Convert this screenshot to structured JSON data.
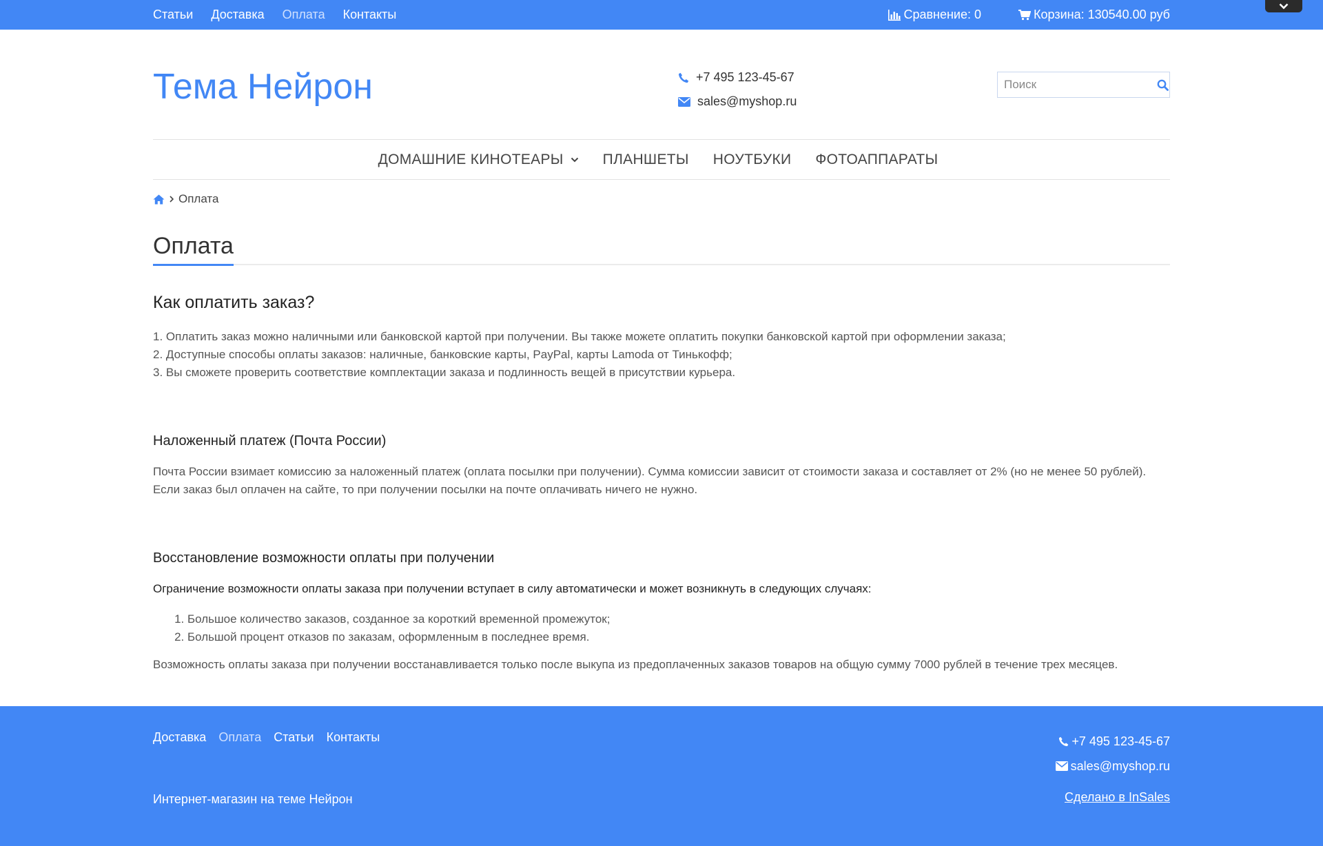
{
  "topbar": {
    "nav": [
      "Статьи",
      "Доставка",
      "Оплата",
      "Контакты"
    ],
    "compare_label": "Сравнение: 0",
    "cart_label": "Корзина: 130540.00 руб"
  },
  "header": {
    "logo": "Тема Нейрон",
    "phone": "+7 495 123-45-67",
    "email": "sales@myshop.ru",
    "search_placeholder": "Поиск"
  },
  "mainnav": [
    "ДОМАШНИЕ КИНОТЕАРЫ",
    "ПЛАНШЕТЫ",
    "НОУТБУКИ",
    "ФОТОАППАРАТЫ"
  ],
  "breadcrumb": {
    "current": "Оплата"
  },
  "page": {
    "title": "Оплата",
    "heading": "Как оплатить заказ?",
    "intro_lines": [
      "1. Оплатить заказ можно наличными или банковской картой при получении. Вы также можете оплатить покупки банковской картой при оформлении заказа;",
      "2. Доступные способы оплаты заказов: наличные, банковские карты, PayPal, карты Lamoda от Тинькофф;",
      "3. Вы сможете проверить соответствие комплектации заказа и подлинность вещей в присутствии курьера."
    ],
    "sec1_title": "Наложенный платеж (Почта России)",
    "sec1_text": "Почта России взимает комиссию за наложенный платеж (оплата посылки при получении). Сумма комиссии зависит от стоимости заказа и составляет от 2% (но не менее 50 рублей). Если заказ был оплачен на сайте, то при получении посылки на почте оплачивать ничего не нужно.",
    "sec2_title": "Восстановление возможности оплаты при получении",
    "sec2_lead": "Ограничение возможности оплаты заказа при получении вступает в силу автоматически и может возникнуть в следующих случаях:",
    "sec2_items": [
      "Большое количество заказов, созданное за короткий временной промежуток;",
      "Большой процент отказов по заказам, оформленным в последнее время."
    ],
    "sec2_text": "Возможность оплаты заказа при получении восстанавливается только после выкупа из предоплаченных заказов товаров на общую сумму 7000 рублей в течение трех месяцев."
  },
  "footer": {
    "nav": [
      "Доставка",
      "Оплата",
      "Статьи",
      "Контакты"
    ],
    "copyright": "Интернет-магазин на теме Нейрон",
    "phone": "+7 495 123-45-67",
    "email": "sales@myshop.ru",
    "made_by": "Сделано в InSales"
  },
  "colors": {
    "accent": "#4287f5",
    "text": "#333333",
    "muted": "#555555"
  }
}
